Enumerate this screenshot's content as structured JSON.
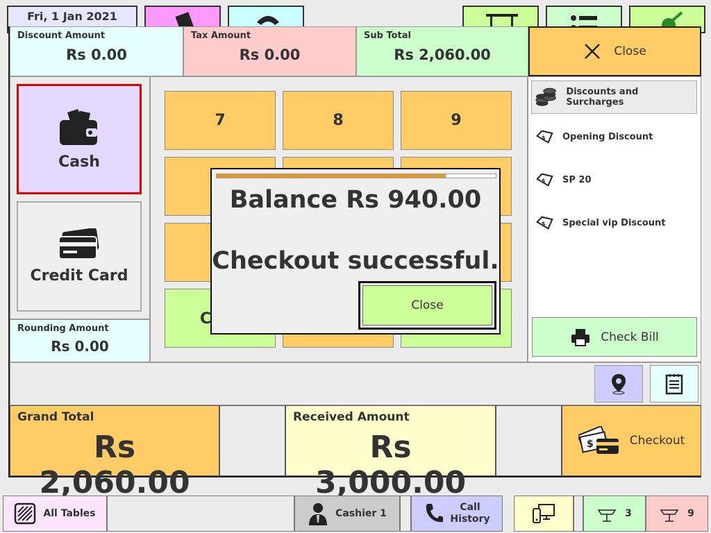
{
  "header": {
    "date": "Fri, 1 Jan 2021"
  },
  "summary": {
    "discount": {
      "label": "Discount Amount",
      "value": "Rs 0.00"
    },
    "tax": {
      "label": "Tax Amount",
      "value": "Rs 0.00"
    },
    "subtotal": {
      "label": "Sub Total",
      "value": "Rs 2,060.00"
    },
    "close_label": "Close"
  },
  "payment_methods": [
    {
      "label": "Cash",
      "selected": true
    },
    {
      "label": "Credit Card",
      "selected": false
    }
  ],
  "rounding": {
    "label": "Rounding Amount",
    "value": "Rs 0.00"
  },
  "keypad": {
    "keys": [
      "7",
      "8",
      "9"
    ],
    "partial_key": "C"
  },
  "discounts": {
    "header": "Discounts and Surcharges",
    "items": [
      "Opening Discount",
      "SP 20",
      "Special vip Discount"
    ],
    "check_bill": "Check Bill"
  },
  "totals": {
    "grand": {
      "label": "Grand Total",
      "value": "Rs 2,060.00"
    },
    "received": {
      "label": "Received Amount",
      "value": "Rs 3,000.00"
    },
    "checkout_label": "Checkout"
  },
  "footer": {
    "all_tables": "All Tables",
    "cashier": "Cashier 1",
    "call_history_line1": "Call",
    "call_history_line2": "History",
    "badge_green": "3",
    "badge_red": "9"
  },
  "dialog": {
    "balance": "Balance Rs 940.00",
    "message": "Checkout successful.",
    "close_label": "Close",
    "progress": 0.82
  },
  "colors": {
    "cash_bg": "#e6d9ff",
    "cash_border": "#e00000",
    "orange": "#ffcc66",
    "green": "#ccffcc",
    "lime": "#ccff99",
    "cyan": "#e6ffff",
    "pink": "#ffcccc",
    "yellow": "#ffffcc",
    "lavender": "#ccccff",
    "magenta": "#ff99ff",
    "gray": "#cccccc"
  }
}
